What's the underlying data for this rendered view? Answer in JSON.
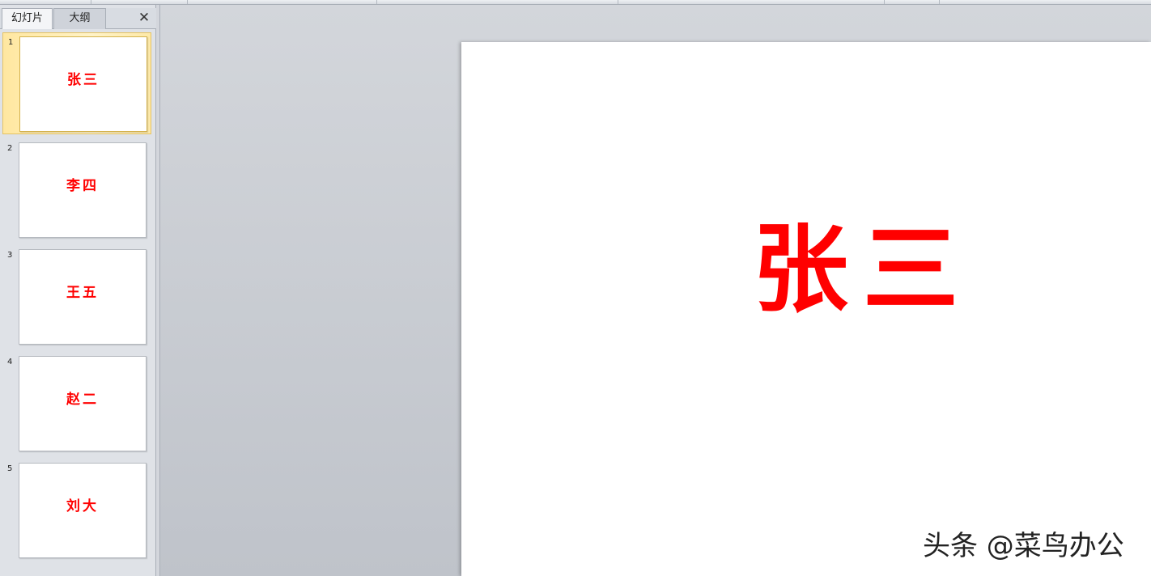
{
  "left_panel": {
    "tabs": [
      {
        "label": "幻灯片",
        "active": true
      },
      {
        "label": "大纲",
        "active": false
      }
    ],
    "close_icon": "close-icon",
    "thumbnails": [
      {
        "number": "1",
        "title": "张三",
        "selected": true
      },
      {
        "number": "2",
        "title": "李四",
        "selected": false
      },
      {
        "number": "3",
        "title": "王五",
        "selected": false
      },
      {
        "number": "4",
        "title": "赵二",
        "selected": false
      },
      {
        "number": "5",
        "title": "刘大",
        "selected": false
      }
    ]
  },
  "editor": {
    "slide_title": "张三",
    "watermark": "头条 @菜鸟办公"
  },
  "colors": {
    "title_red": "#ff0000",
    "selection_yellow": "#ffe7a0",
    "panel_bg": "#dfe2e7"
  }
}
